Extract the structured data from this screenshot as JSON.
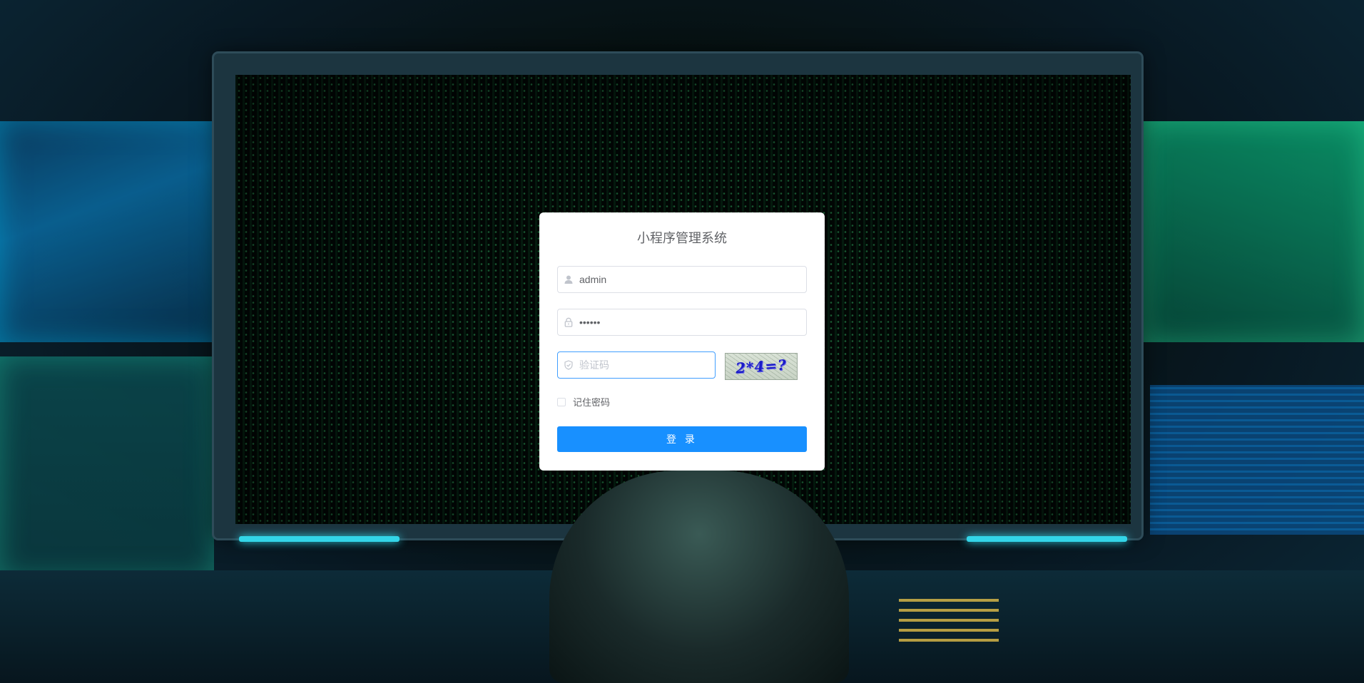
{
  "login": {
    "title": "小程序管理系统",
    "username": {
      "value": "admin",
      "icon": "user-icon"
    },
    "password": {
      "value": "••••••",
      "icon": "lock-icon"
    },
    "captcha": {
      "placeholder": "验证码",
      "icon": "shield-icon",
      "image_text": "2*4=?"
    },
    "remember_label": "记住密码",
    "remember_checked": false,
    "submit_label": "登 录"
  },
  "colors": {
    "primary": "#1890ff",
    "focus_border": "#409eff",
    "captcha_text": "#1a1ac8"
  }
}
